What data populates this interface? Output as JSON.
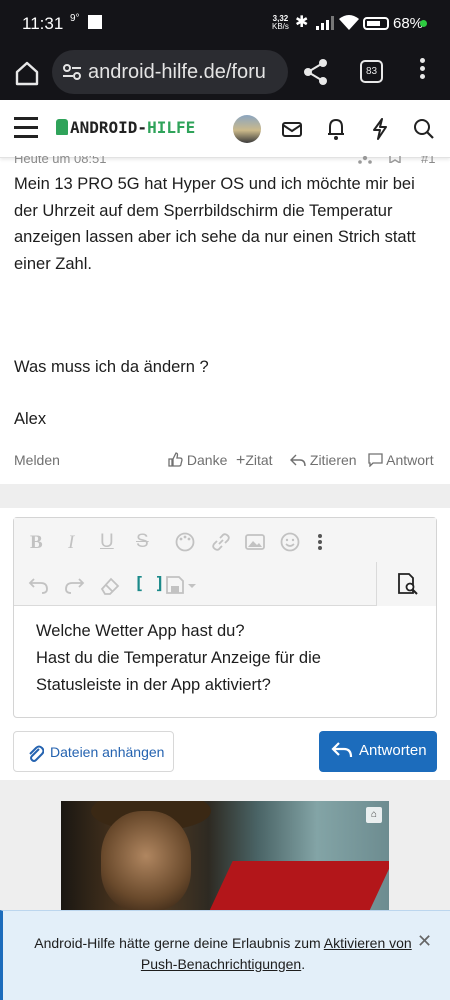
{
  "status_bar": {
    "time": "11:31",
    "temperature": "9°",
    "net_speed": "3,32",
    "net_unit": "KB/s",
    "battery": "68%"
  },
  "browser": {
    "url": "android-hilfe.de/foru",
    "tab_count": "83"
  },
  "site": {
    "logo_prefix": "ANDROID-",
    "logo_suffix": "HILFE"
  },
  "post": {
    "meta": "Heute um 08:51",
    "post_number": "#1",
    "paragraph_1": "Mein 13 PRO 5G hat Hyper OS und ich möchte mir bei der Uhrzeit auf dem Sperrbildschirm die Temperatur anzeigen lassen aber ich sehe da nur einen Strich statt einer Zahl.",
    "paragraph_2": "Was muss ich da ändern ?",
    "paragraph_3": "Alex",
    "actions": {
      "report": "Melden",
      "thanks": "Danke",
      "quote": "Zitat",
      "cite": "Zitieren",
      "reply": "Antwort"
    }
  },
  "editor": {
    "line_1": "Welche Wetter App hast du?",
    "line_2": "Hast du die Temperatur Anzeige für die",
    "line_3": "Statusleiste in der App aktiviert?"
  },
  "buttons": {
    "attach": "Dateien anhängen",
    "submit": "Antworten"
  },
  "notice": {
    "text_before": "Android-Hilfe hätte gerne deine Erlaubnis zum ",
    "link": "Aktivieren von Push-Benachrichtigungen",
    "text_after": "."
  },
  "colors": {
    "brand_green": "#2fa35a",
    "primary_blue": "#1c6cbc",
    "notice_bg": "#e3eff9"
  }
}
